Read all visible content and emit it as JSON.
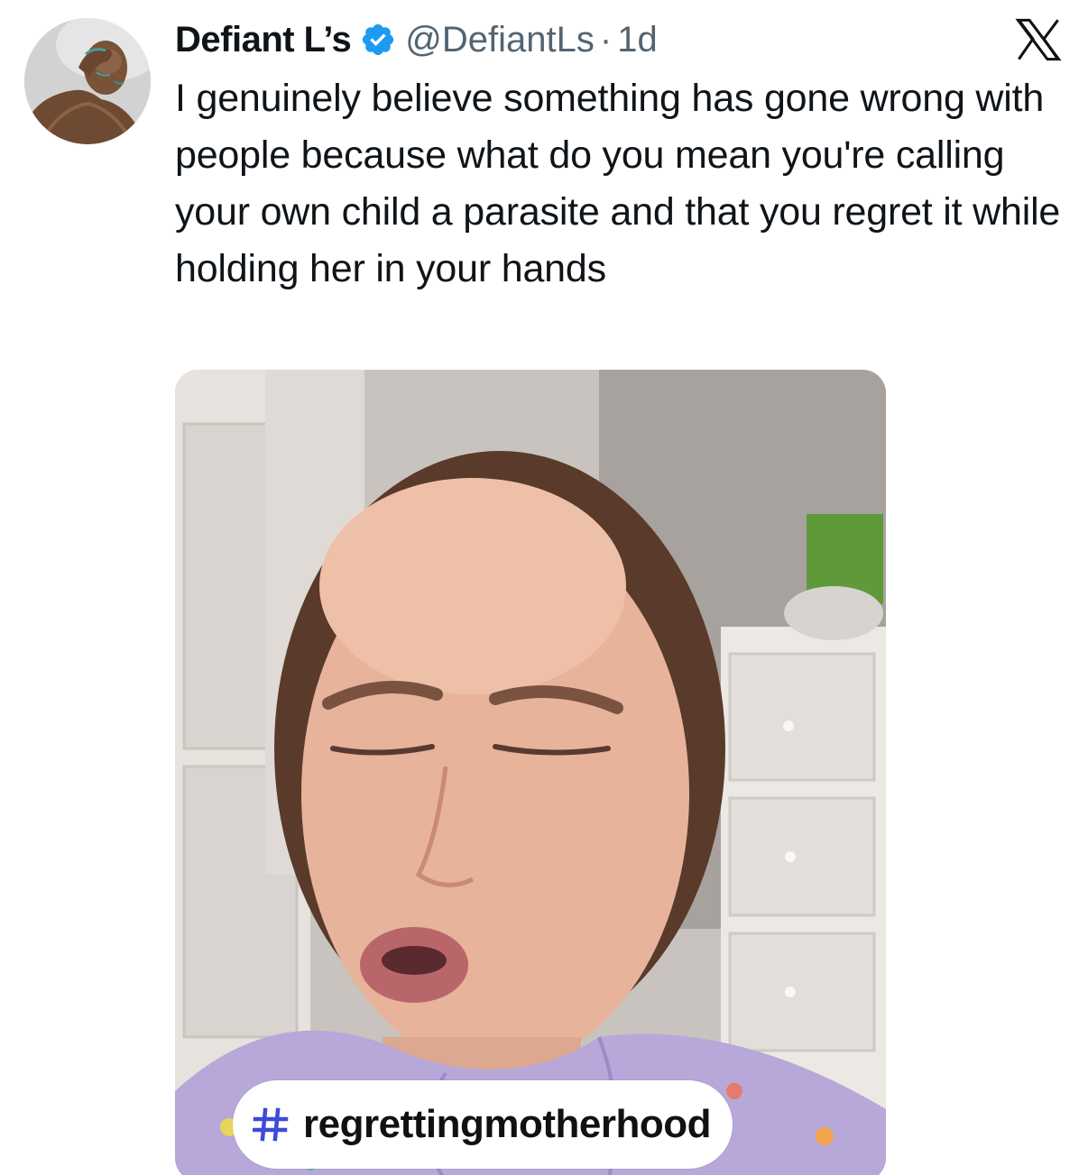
{
  "author": {
    "display_name": "Defiant L’s",
    "handle": "@DefiantLs",
    "separator": "·",
    "time": "1d",
    "verified": true
  },
  "tweet": {
    "text": "I genuinely believe something has gone wrong with people because what do you mean you're calling your own child a parasite and that you regret it while holding her in your hands"
  },
  "media": {
    "type": "video-still",
    "hashtag_label": "regrettingmotherhood",
    "hashtag_icon": "hash-icon"
  },
  "brand": {
    "icon": "x-logo-icon"
  },
  "colors": {
    "text_primary": "#0f1419",
    "text_secondary": "#536471",
    "verified_blue": "#1d9bf0",
    "hashtag_accent": "#3c4bd8",
    "pajama_lavender": "#b7a8d9"
  }
}
